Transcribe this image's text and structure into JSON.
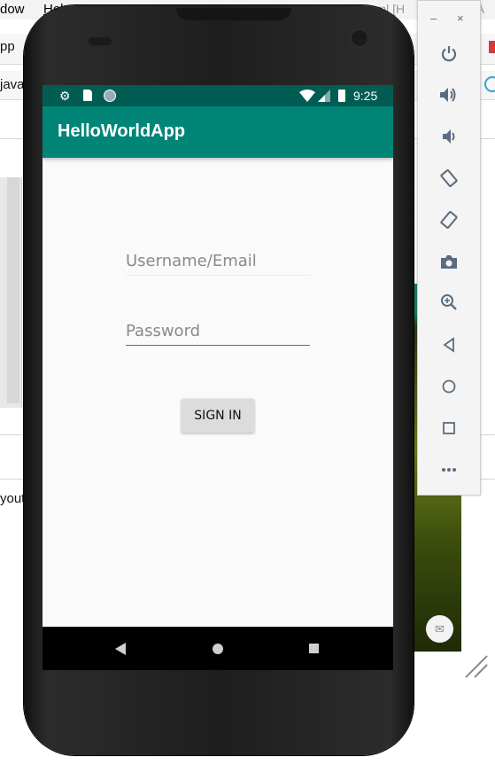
{
  "ide": {
    "menu_left": "dow",
    "menu_help": "Help",
    "tab_text": "ge.xml [H",
    "tab_text2": "dA",
    "row1_text": "pp",
    "row2_text": "java",
    "left_text": "yout"
  },
  "status_bar": {
    "time": "9:25",
    "icons": [
      "settings-icon",
      "sd-card-icon",
      "circle-icon",
      "wifi-icon",
      "signal-icon",
      "battery-icon"
    ]
  },
  "app_bar": {
    "title": "HelloWorldApp"
  },
  "form": {
    "username_placeholder": "Username/Email",
    "password_placeholder": "Password",
    "sign_in_label": "SIGN IN"
  },
  "emulator_toolbar": {
    "minimize": "–",
    "close": "×",
    "buttons": [
      "power-icon",
      "volume-up-icon",
      "volume-down-icon",
      "rotate-left-icon",
      "rotate-right-icon",
      "camera-icon",
      "zoom-icon",
      "back-icon",
      "home-icon",
      "overview-icon",
      "more-icon"
    ]
  },
  "colors": {
    "primary": "#008577",
    "primary_dark": "#015d53",
    "background": "#fafafa",
    "button": "#dcdcdc"
  }
}
